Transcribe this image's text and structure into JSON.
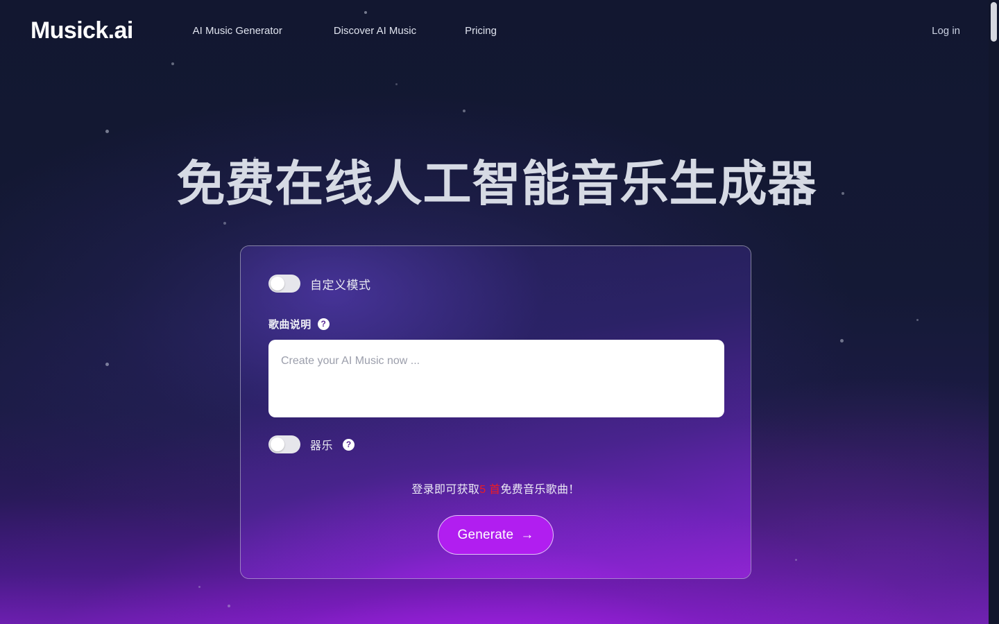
{
  "header": {
    "logo": "Musick.ai",
    "nav": [
      {
        "label": "AI Music Generator",
        "name": "nav-ai-music-generator"
      },
      {
        "label": "Discover AI Music",
        "name": "nav-discover-ai-music"
      },
      {
        "label": "Pricing",
        "name": "nav-pricing"
      }
    ],
    "login_label": "Log in"
  },
  "hero": {
    "title": "免费在线人工智能音乐生成器"
  },
  "generator": {
    "custom_mode": {
      "label": "自定义模式",
      "state": "off"
    },
    "song_description": {
      "label": "歌曲说明",
      "help_glyph": "?",
      "value": "",
      "placeholder": "Create your AI Music now ..."
    },
    "instrumental": {
      "label": "器乐",
      "help_glyph": "?",
      "state": "off"
    },
    "promo": {
      "prefix": "登录即可获取",
      "highlight": "5 首",
      "suffix": "免费音乐歌曲！"
    },
    "generate_button": {
      "label": "Generate",
      "arrow": "→"
    }
  },
  "colors": {
    "page_background": "#131830",
    "accent_purple": "#b11ef0",
    "promo_highlight": "#ec1c24",
    "heading_text": "#d6dae4",
    "card_border": "#dbd6f0"
  },
  "scrollbar": {
    "thumb_position": "top"
  }
}
